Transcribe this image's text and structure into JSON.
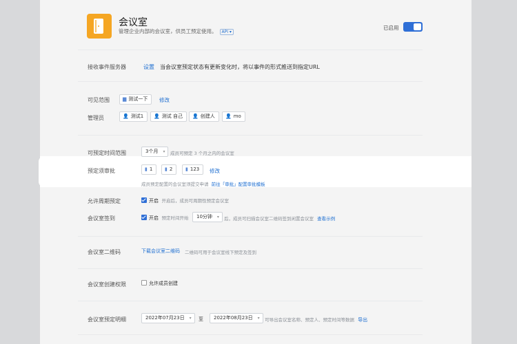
{
  "header": {
    "title": "会议室",
    "subtitle": "管理企业内部的会议室，供员工预定使用。",
    "api_badge": "API",
    "status_label": "已启用",
    "enabled": true
  },
  "event_server": {
    "label": "接收事件服务器",
    "link": "设置",
    "desc": "当会议室预定状态有更新变化时，将以事件的形式推送到指定URL"
  },
  "visibility": {
    "label": "可见范围",
    "items": [
      "测试一下"
    ],
    "edit": "修改"
  },
  "admins": {
    "label": "管理员",
    "items": [
      "测试1",
      "测试 自己",
      "创建人",
      "mo"
    ]
  },
  "booking_range": {
    "label": "可预定时间范围",
    "value": "3个月",
    "desc": "成员可预定 3 个月之内的会议室"
  },
  "approval": {
    "label": "预定须审批",
    "items": [
      "1",
      "2",
      "123"
    ],
    "edit": "修改",
    "hint": "成员预定配置的会议室须提交申请",
    "hint_link": "前往「审批」配置审批模板"
  },
  "recurring": {
    "label": "允许周期预定",
    "check": "开启",
    "desc": "开启后，成员可周期性预定会议室",
    "checked": true
  },
  "checkin": {
    "label": "会议室签到",
    "check": "开启",
    "prefix": "预定时间开始",
    "minutes": "10分钟",
    "desc": "后，成员可扫描会议室二维码签到闲置会议室",
    "example": "查看示例",
    "checked": true
  },
  "qrcode": {
    "label": "会议室二维码",
    "link": "下载会议室二维码",
    "desc": "二维码可用于会议室线下预定及签到"
  },
  "create_perm": {
    "label": "会议室创建权限",
    "check": "允许成员创建",
    "checked": false
  },
  "details": {
    "label": "会议室预定明细",
    "from": "2022年07月23日",
    "to_label": "至",
    "to": "2022年08月23日",
    "desc": "可导出会议室名称、预定人、预定时间等数据",
    "export": "导出"
  },
  "colors": {
    "accent": "#2f6fd6",
    "logo": "#f5a623",
    "link": "#1f6fd1"
  },
  "icons": {
    "app": "door-icon",
    "folder": "folder-icon",
    "user": "person-icon",
    "room": "door-icon",
    "caret": "caret-down-icon"
  }
}
